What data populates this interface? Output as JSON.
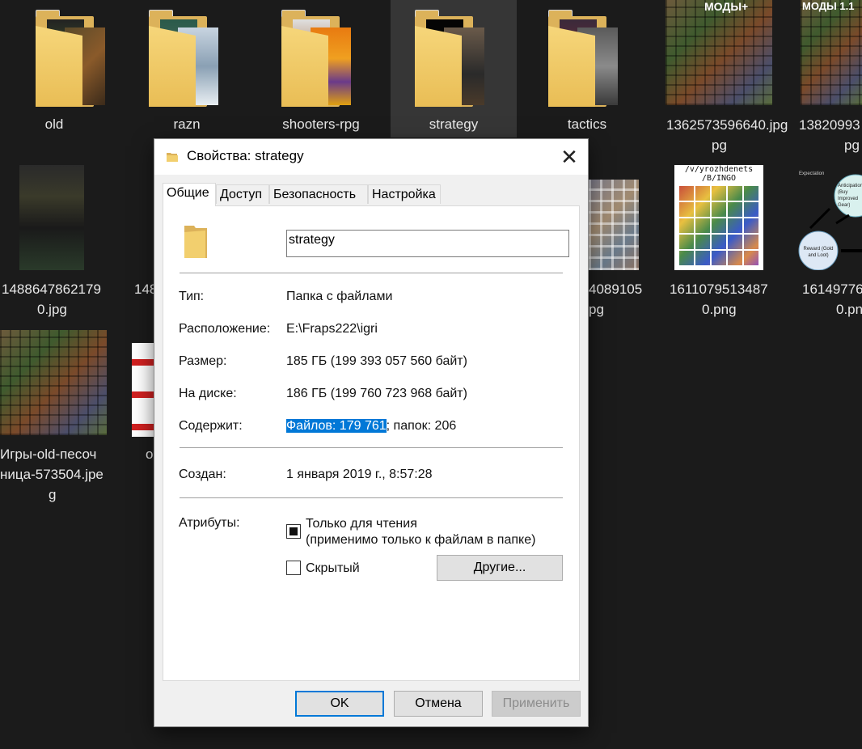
{
  "explorer": {
    "row1": [
      {
        "caption": "old",
        "selected": false
      },
      {
        "caption": "razn",
        "selected": false
      },
      {
        "caption": "shooters-rpg",
        "selected": false
      },
      {
        "caption": "strategy",
        "selected": true
      },
      {
        "caption": "tactics",
        "selected": false
      },
      {
        "caption": "1362573596640.jpg",
        "selected": false
      },
      {
        "caption": "13820993...pg",
        "selected": false
      }
    ],
    "row1_texts": {
      "mods": "МОДЫ+",
      "mods11": "МОДЫ 1.1"
    },
    "row2": [
      {
        "caption": "14886478621790.jpg"
      },
      {
        "caption": "148"
      },
      {
        "caption": "4089105"
      },
      {
        "caption": "pg"
      },
      {
        "caption": "16110795134870.png"
      },
      {
        "caption": "16149776"
      },
      {
        "caption": "0.pn"
      }
    ],
    "row2_texts": {
      "bingo_line1": "/v/yrozhdenets",
      "bingo_line2": "/B/INGO",
      "diagram_anticipation": "Anticipation (Buy Improved Gear)",
      "diagram_reward": "Reward (Gold and Loot)",
      "diagram_small": "Expectation"
    },
    "row3": [
      {
        "caption": "Игры-old-песочница-573504.jpeg"
      },
      {
        "caption": "o"
      }
    ]
  },
  "dialog": {
    "title": "Свойства: strategy",
    "close_glyph": "✕",
    "tabs": [
      "Общие",
      "Доступ",
      "Безопасность",
      "Настройка"
    ],
    "name_value": "strategy",
    "rows": {
      "type_label": "Тип:",
      "type_value": "Папка с файлами",
      "location_label": "Расположение:",
      "location_value": "E:\\Fraps222\\igri",
      "size_label": "Размер:",
      "size_value": "185 ГБ (199 393 057 560 байт)",
      "ondisk_label": "На диске:",
      "ondisk_value": "186 ГБ (199 760 723 968 байт)",
      "contains_label": "Содержит:",
      "contains_files": "Файлов: 179 761",
      "contains_folders": "; папок: 206",
      "created_label": "Создан:",
      "created_value": "1 января 2019 г., 8:57:28",
      "attributes_label": "Атрибуты:"
    },
    "attributes": {
      "readonly_label": "Только для чтения",
      "readonly_note": "(применимо только к файлам в папке)",
      "readonly_state": "indeterminate",
      "hidden_label": "Скрытый",
      "hidden_checked": false,
      "other_button": "Другие..."
    },
    "buttons": {
      "ok": "OK",
      "cancel": "Отмена",
      "apply": "Применить"
    },
    "colors": {
      "selection": "#0078d7",
      "folder": "#dcb25a"
    }
  }
}
